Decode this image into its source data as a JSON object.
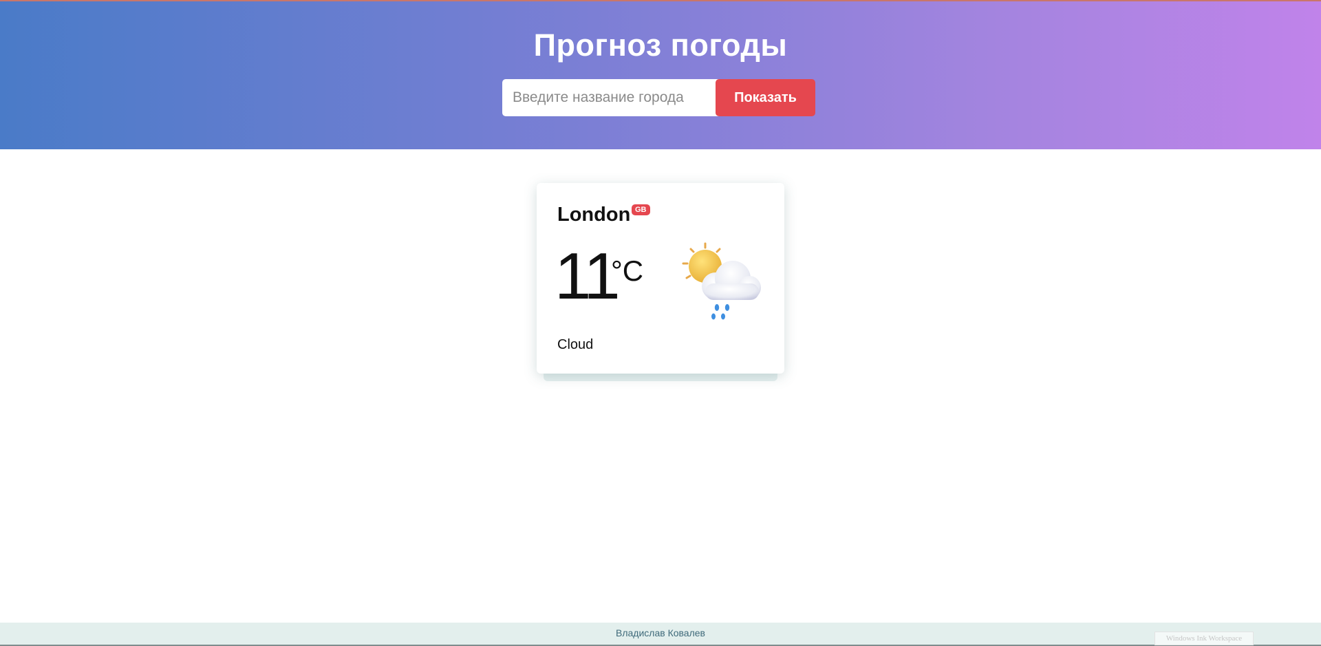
{
  "header": {
    "title": "Прогноз погоды",
    "search": {
      "placeholder": "Введите название города",
      "value": "",
      "button_label": "Показать"
    },
    "colors": {
      "gradient_start": "#4a7bc8",
      "gradient_end": "#c083ea",
      "accent": "#e5474f"
    }
  },
  "weather_card": {
    "city": "London",
    "country_code": "GB",
    "temperature": "11",
    "unit": "°C",
    "description": "Cloud",
    "icon": "sun-behind-rain-cloud-icon"
  },
  "footer": {
    "author": "Владислав Ковалев"
  },
  "overlay": {
    "watermark": "Windows Ink Workspace"
  }
}
